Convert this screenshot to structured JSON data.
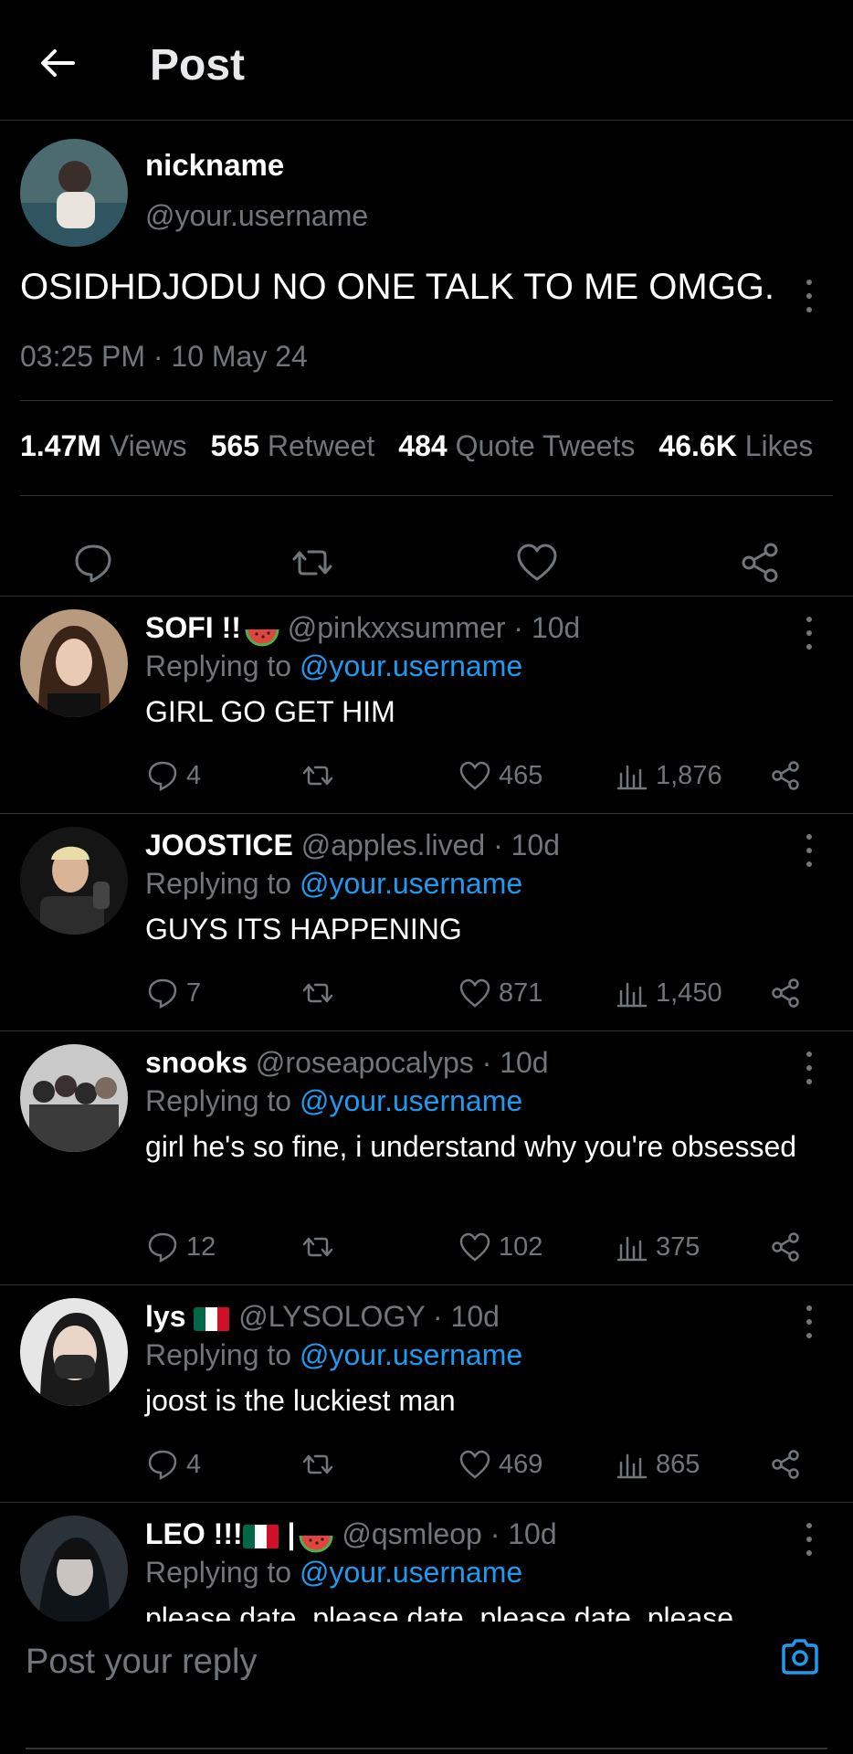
{
  "header": {
    "title": "Post"
  },
  "post": {
    "name": "nickname",
    "handle": "@your.username",
    "text": "OSIDHDJODU NO ONE TALK TO ME OMGG.",
    "time": "03:25 PM · 10 May 24",
    "stats": [
      {
        "value": "1.47M",
        "label": "Views"
      },
      {
        "value": "565",
        "label": "Retweet"
      },
      {
        "value": "484",
        "label": "Quote Tweets"
      },
      {
        "value": "46.6K",
        "label": "Likes"
      }
    ],
    "actions": [
      "reply-icon",
      "retweet-icon",
      "like-icon",
      "share-icon"
    ]
  },
  "replies": [
    {
      "name": "SOFI !!",
      "handle": "@pinkxxsummer · 10d",
      "replying_prefix": "Replying to ",
      "replying_to": "@your.username",
      "text": "GIRL GO GET HIM",
      "comments": "4",
      "likes": "465",
      "views": "1,876"
    },
    {
      "name": "JOOSTICE",
      "handle": "@apples.lived · 10d",
      "replying_prefix": "Replying to ",
      "replying_to": "@your.username",
      "text": "GUYS ITS HAPPENING",
      "comments": "7",
      "likes": "871",
      "views": "1,450"
    },
    {
      "name": "snooks",
      "handle": "@roseapocalyps · 10d",
      "replying_prefix": "Replying to ",
      "replying_to": "@your.username",
      "text": "girl he's so fine, i understand why you're obsessed",
      "comments": "12",
      "likes": "102",
      "views": "375"
    },
    {
      "name": "lys",
      "handle": "@LYSOLOGY · 10d",
      "replying_prefix": "Replying to ",
      "replying_to": "@your.username",
      "text": "joost is the luckiest man",
      "comments": "4",
      "likes": "469",
      "views": "865"
    },
    {
      "name": "LEO !!!",
      "name_sep": " |",
      "handle": "@qsmleop · 10d",
      "replying_prefix": "Replying to ",
      "replying_to": "@your.username",
      "text": "please date, please date, please date, please"
    }
  ],
  "reply_bar": {
    "placeholder": "Post your reply"
  },
  "colors": {
    "accent": "#1d9bf0",
    "muted": "#71767b",
    "divider": "#2f3336"
  }
}
